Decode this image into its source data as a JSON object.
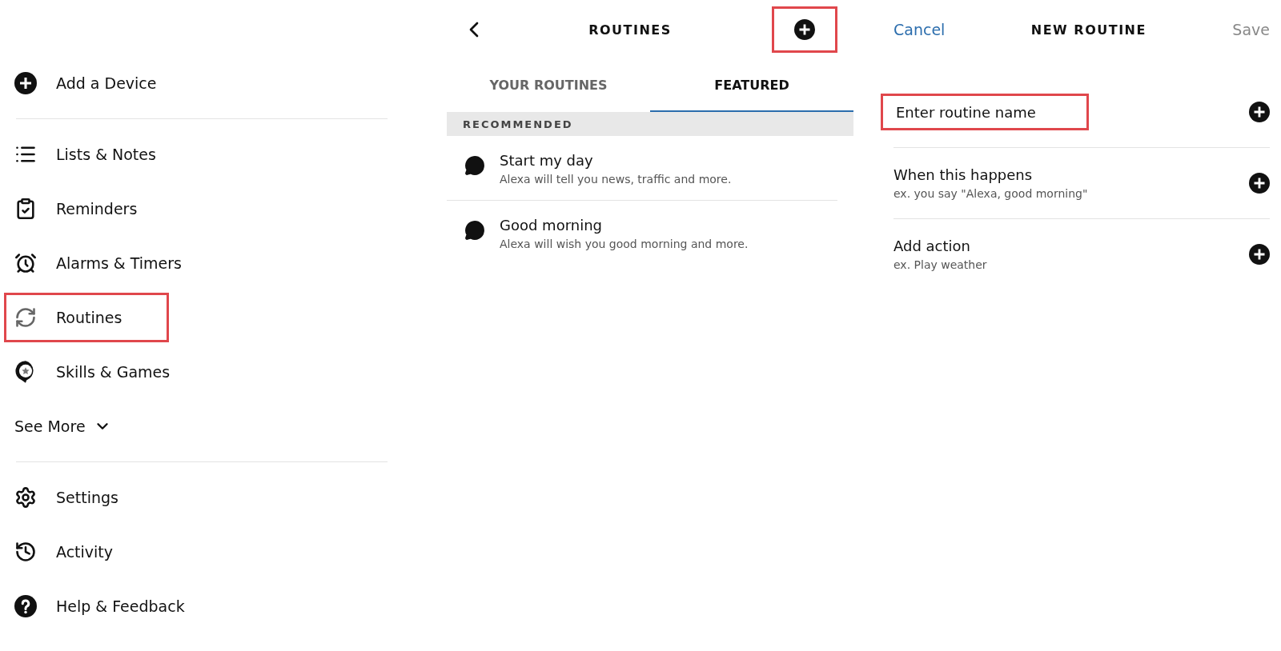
{
  "menu": {
    "items": [
      {
        "label": "Add a Device",
        "highlighted": false,
        "divider_after": true
      },
      {
        "label": "Lists & Notes",
        "highlighted": false,
        "divider_after": false
      },
      {
        "label": "Reminders",
        "highlighted": false,
        "divider_after": false
      },
      {
        "label": "Alarms & Timers",
        "highlighted": false,
        "divider_after": false
      },
      {
        "label": "Routines",
        "highlighted": true,
        "divider_after": false
      },
      {
        "label": "Skills & Games",
        "highlighted": false,
        "divider_after": false
      }
    ],
    "see_more": {
      "label": "See More",
      "expanded": false
    },
    "bottom_items": [
      {
        "label": "Settings",
        "highlighted": false
      },
      {
        "label": "Activity",
        "highlighted": false
      },
      {
        "label": "Help & Feedback",
        "highlighted": false
      }
    ]
  },
  "routines": {
    "title": "ROUTINES",
    "add_highlighted": true,
    "tabs": [
      {
        "label": "YOUR ROUTINES",
        "selected": false
      },
      {
        "label": "FEATURED",
        "selected": true
      }
    ],
    "section": "RECOMMENDED",
    "items": [
      {
        "title": "Start my day",
        "subtitle": "Alexa will tell you news, traffic and more."
      },
      {
        "title": "Good morning",
        "subtitle": "Alexa will wish you good morning and more."
      }
    ]
  },
  "new_routine": {
    "cancel": "Cancel",
    "title": "NEW ROUTINE",
    "save": "Save",
    "rows": [
      {
        "kind": "field",
        "placeholder": "Enter routine name",
        "highlighted": true
      },
      {
        "kind": "step",
        "title": "When this happens",
        "subtitle": "ex. you say \"Alexa, good morning\""
      },
      {
        "kind": "step",
        "title": "Add action",
        "subtitle": "ex. Play weather"
      }
    ]
  }
}
